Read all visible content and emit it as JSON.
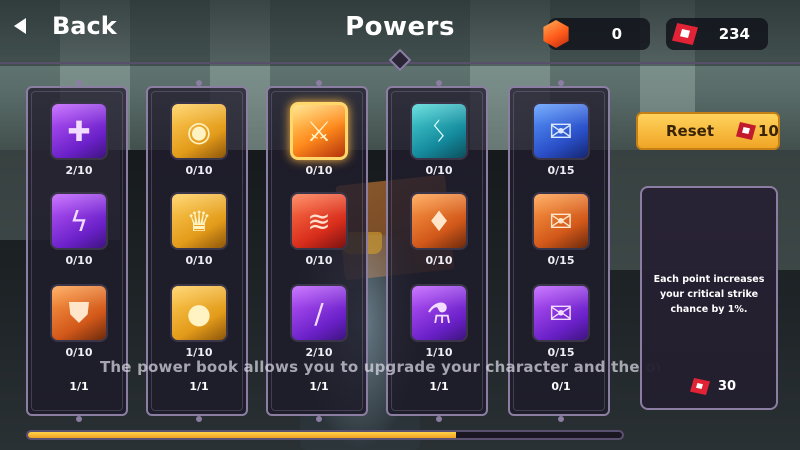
{
  "header": {
    "back_label": "Back",
    "title": "Powers",
    "currencies": [
      {
        "icon": "orange-gem-icon",
        "value": "0"
      },
      {
        "icon": "red-gem-icon",
        "value": "234"
      }
    ]
  },
  "columns": [
    {
      "powers": [
        {
          "icon": "purple-plus-icon",
          "level": "2/10",
          "color": "#8a33e0"
        },
        {
          "icon": "lightning-shield-icon",
          "level": "0/10",
          "color": "#7a2fd0"
        },
        {
          "icon": "shield-icon",
          "level": "0/10",
          "color": "#d2581a"
        }
      ],
      "footer": "1/1"
    },
    {
      "powers": [
        {
          "icon": "gold-bag-icon",
          "level": "0/10",
          "color": "#e39b1a"
        },
        {
          "icon": "crown-icon",
          "level": "0/10",
          "color": "#e39b1a"
        },
        {
          "icon": "gold-coins-icon",
          "level": "1/10",
          "color": "#e39b1a"
        }
      ],
      "footer": "1/1"
    },
    {
      "powers": [
        {
          "icon": "sword-icon",
          "level": "0/10",
          "color": "#ff8a1c",
          "selected": true
        },
        {
          "icon": "claw-slash-icon",
          "level": "0/10",
          "color": "#d82d1c"
        },
        {
          "icon": "dagger-icon",
          "level": "2/10",
          "color": "#8a33e0"
        }
      ],
      "footer": "1/1"
    },
    {
      "powers": [
        {
          "icon": "teal-rune-icon",
          "level": "0/10",
          "color": "#14899c"
        },
        {
          "icon": "fire-rune-icon",
          "level": "0/10",
          "color": "#d2581a"
        },
        {
          "icon": "potion-icon",
          "level": "1/10",
          "color": "#8a33e0"
        }
      ],
      "footer": "1/1"
    },
    {
      "powers": [
        {
          "icon": "blue-scroll-icon",
          "level": "0/15",
          "color": "#2a4fc8"
        },
        {
          "icon": "orange-scroll-icon",
          "level": "0/15",
          "color": "#d2581a"
        },
        {
          "icon": "purple-scroll-icon",
          "level": "0/15",
          "color": "#8a33e0"
        }
      ],
      "footer": "0/1"
    }
  ],
  "banner_text": "The power book allows you to upgrade your character and the overw",
  "reset": {
    "label": "Reset",
    "cost": "10"
  },
  "info": {
    "description": "Each point increases your critical strike chance by 1%.",
    "cost": "30"
  },
  "progress": {
    "fraction": 0.72
  }
}
